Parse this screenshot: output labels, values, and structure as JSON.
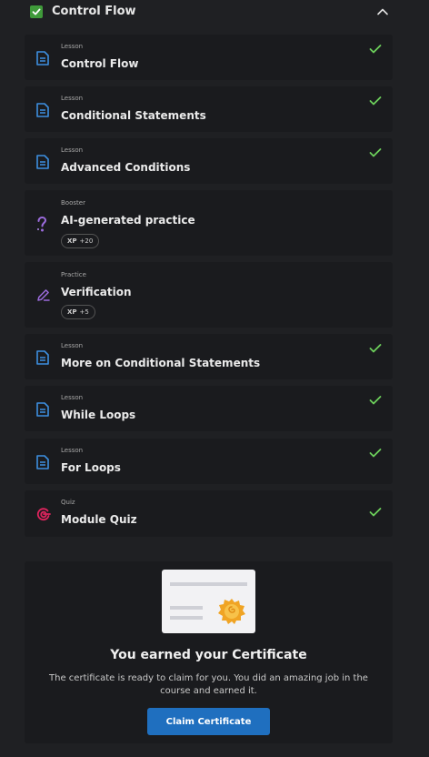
{
  "module": {
    "title": "Control Flow",
    "completed": true
  },
  "items": [
    {
      "kind": "Lesson",
      "title": "Control Flow",
      "icon": "lesson-icon",
      "completed": true
    },
    {
      "kind": "Lesson",
      "title": "Conditional Statements",
      "icon": "lesson-icon",
      "completed": true
    },
    {
      "kind": "Lesson",
      "title": "Advanced Conditions",
      "icon": "lesson-icon",
      "completed": true
    },
    {
      "kind": "Booster",
      "title": "AI-generated practice",
      "icon": "question-mark-icon",
      "completed": false,
      "xp_label": "XP",
      "xp_value": "+20"
    },
    {
      "kind": "Practice",
      "title": "Verification",
      "icon": "pencil-icon",
      "completed": false,
      "xp_label": "XP",
      "xp_value": "+5"
    },
    {
      "kind": "Lesson",
      "title": "More on Conditional Statements",
      "icon": "lesson-icon",
      "completed": true
    },
    {
      "kind": "Lesson",
      "title": "While Loops",
      "icon": "lesson-icon",
      "completed": true
    },
    {
      "kind": "Lesson",
      "title": "For Loops",
      "icon": "lesson-icon",
      "completed": true
    },
    {
      "kind": "Quiz",
      "title": "Module Quiz",
      "icon": "target-icon",
      "completed": true
    }
  ],
  "certificate": {
    "title": "You earned your Certificate",
    "text": "The certificate is ready to claim for you. You did an amazing job in the course and earned it.",
    "button_label": "Claim Certificate"
  },
  "colors": {
    "background": "#1f2023",
    "card": "#1a1b1e",
    "check_green": "#6ccf5b",
    "lesson_blue": "#3d8fe0",
    "booster_purple": "#9b6bdc",
    "quiz_red": "#e0245e",
    "button_blue": "#1f6fbf"
  }
}
